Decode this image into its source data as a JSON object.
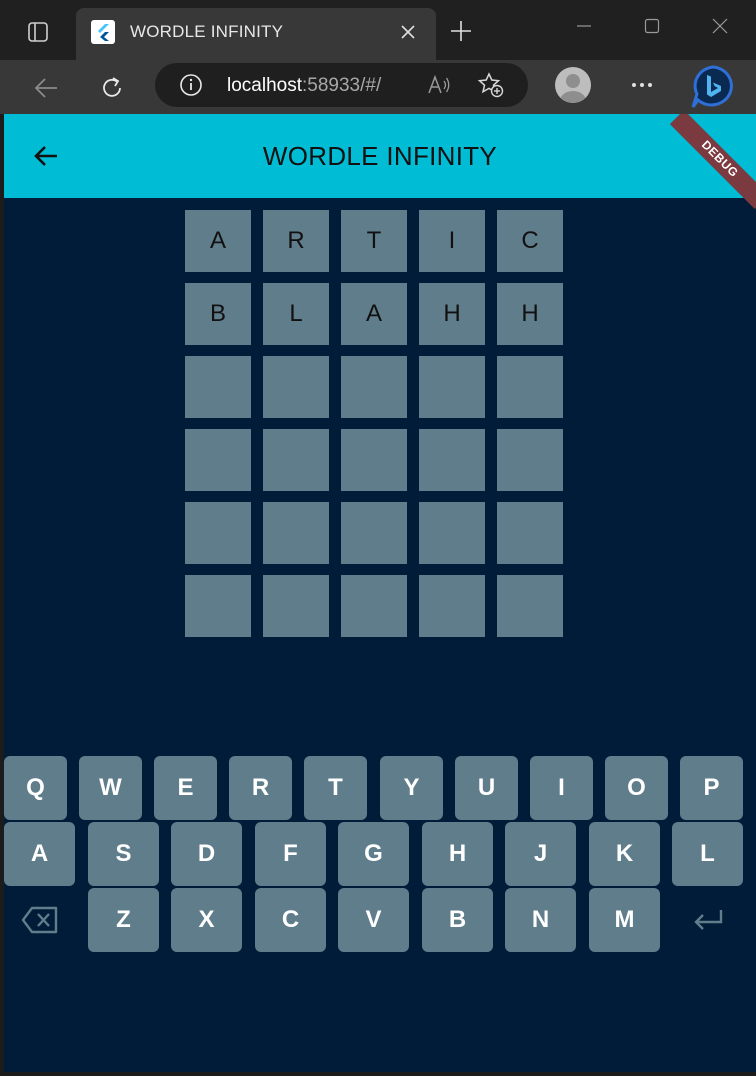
{
  "browser": {
    "tab_title": "WORDLE INFINITY",
    "url_host": "localhost",
    "url_rest": ":58933/#/"
  },
  "app": {
    "title": "WORDLE INFINITY",
    "debug_banner": "DEBUG",
    "colors": {
      "appbar": "#00bcd4",
      "background": "#001c38",
      "tile": "#607d8b"
    },
    "grid": [
      [
        "A",
        "R",
        "T",
        "I",
        "C"
      ],
      [
        "B",
        "L",
        "A",
        "H",
        "H"
      ],
      [
        "",
        "",
        "",
        "",
        ""
      ],
      [
        "",
        "",
        "",
        "",
        ""
      ],
      [
        "",
        "",
        "",
        "",
        ""
      ],
      [
        "",
        "",
        "",
        "",
        ""
      ]
    ],
    "keyboard": {
      "row1": [
        "Q",
        "W",
        "E",
        "R",
        "T",
        "Y",
        "U",
        "I",
        "O",
        "P"
      ],
      "row2": [
        "A",
        "S",
        "D",
        "F",
        "G",
        "H",
        "J",
        "K",
        "L"
      ],
      "row3": [
        "Z",
        "X",
        "C",
        "V",
        "B",
        "N",
        "M"
      ],
      "backspace_icon": "backspace-icon",
      "enter_icon": "enter-icon"
    }
  }
}
